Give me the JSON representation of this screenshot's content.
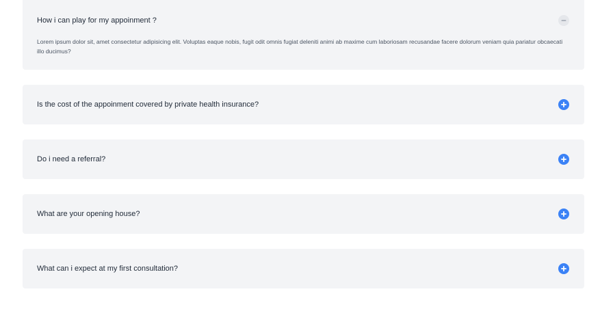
{
  "faq": {
    "items": [
      {
        "question": "How i can play for my appoinment ?",
        "answer": "Lorem ipsum dolor sit, amet consectetur adipisicing elit. Voluptas eaque nobis, fugit odit omnis fugiat deleniti animi ab maxime cum laboriosam recusandae facere dolorum veniam quia pariatur obcaecati illo ducimus?",
        "expanded": true,
        "icon": "minus-circle-icon"
      },
      {
        "question": "Is the cost of the appoinment covered by private health insurance?",
        "expanded": false,
        "icon": "plus-circle-icon"
      },
      {
        "question": "Do i need a referral?",
        "expanded": false,
        "icon": "plus-circle-icon"
      },
      {
        "question": "What are your opening house?",
        "expanded": false,
        "icon": "plus-circle-icon"
      },
      {
        "question": "What can i expect at my first consultation?",
        "expanded": false,
        "icon": "plus-circle-icon"
      }
    ]
  },
  "colors": {
    "card_background": "#f3f4f6",
    "accent": "#3b82f6",
    "collapse_icon_background": "#e5e7eb",
    "collapse_icon_glyph": "#9ca3af",
    "question_text": "#1f2937",
    "answer_text": "#4b5563"
  }
}
